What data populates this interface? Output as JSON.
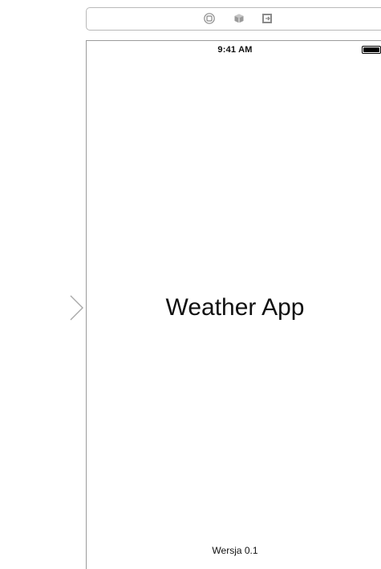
{
  "scene_dock": {
    "icons": [
      "view-controller-icon",
      "first-responder-icon",
      "exit-icon"
    ]
  },
  "device": {
    "status_bar": {
      "time": "9:41 AM",
      "battery_level": 1.0
    }
  },
  "content": {
    "title": "Weather App",
    "version": "Wersja 0.1"
  },
  "colors": {
    "frame_border": "#9b9b9b",
    "dock_border": "#b9b9b9",
    "arrow": "#a8a8a8",
    "text": "#111111",
    "background": "#ffffff"
  }
}
